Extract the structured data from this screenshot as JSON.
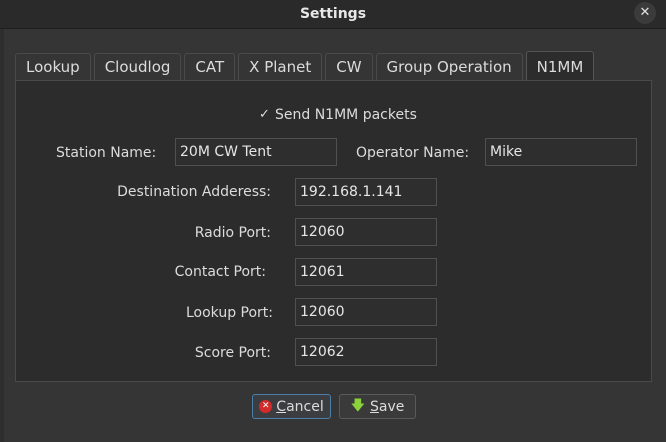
{
  "window": {
    "title": "Settings",
    "close_glyph": "✕"
  },
  "tabs": [
    {
      "label": "Lookup"
    },
    {
      "label": "Cloudlog"
    },
    {
      "label": "CAT"
    },
    {
      "label": "X Planet"
    },
    {
      "label": "CW"
    },
    {
      "label": "Group Operation"
    },
    {
      "label": "N1MM",
      "active": true
    }
  ],
  "n1mm": {
    "send_packets": {
      "label": "Send N1MM packets",
      "checked": true,
      "check_glyph": "✓"
    },
    "station_name": {
      "label": "Station Name:",
      "value": "20M CW Tent"
    },
    "operator_name": {
      "label": "Operator Name:",
      "value": "Mike"
    },
    "destination_address": {
      "label": "Destination Adderess:",
      "value": "192.168.1.141"
    },
    "radio_port": {
      "label": "Radio Port:",
      "value": "12060"
    },
    "contact_port": {
      "label": "Contact Port:",
      "value": "12061"
    },
    "lookup_port": {
      "label": "Lookup Port:",
      "value": "12060"
    },
    "score_port": {
      "label": "Score Port:",
      "value": "12062"
    }
  },
  "buttons": {
    "cancel": {
      "label_first": "C",
      "label_rest": "ancel",
      "icon": "cancel-icon"
    },
    "save": {
      "label_first": "S",
      "label_rest": "ave",
      "icon": "save-arrow-icon"
    }
  },
  "colors": {
    "background": "#353535",
    "panel": "#2c2c2c",
    "cancel_icon": "#d22b2b",
    "save_icon": "#8bd13a",
    "focus": "#4a7fa7"
  }
}
